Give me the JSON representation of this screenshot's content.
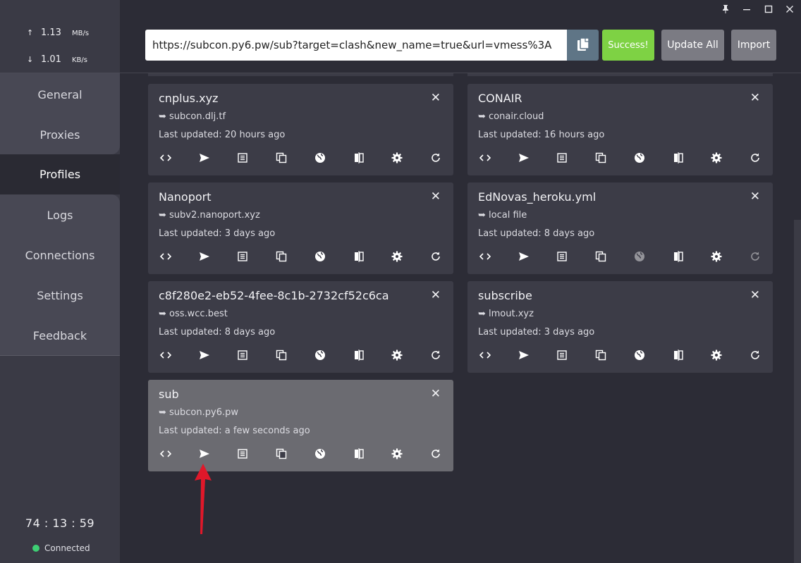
{
  "window_controls": [
    "pin-icon",
    "minimize-icon",
    "maximize-icon",
    "close-icon"
  ],
  "traffic": {
    "up_arrow": "↑",
    "up_value": "1.13",
    "up_unit": "MB/s",
    "down_arrow": "↓",
    "down_value": "1.01",
    "down_unit": "KB/s"
  },
  "nav": {
    "general": "General",
    "proxies": "Proxies",
    "profiles": "Profiles",
    "logs": "Logs",
    "connections": "Connections",
    "settings": "Settings",
    "feedback": "Feedback"
  },
  "active_nav": "Profiles",
  "uptime": "74 : 13 : 59",
  "connection_status": "Connected",
  "toolbar": {
    "url_value": "https://subcon.py6.pw/sub?target=clash&new_name=true&url=vmess%3A",
    "success_label": "Success!",
    "update_all_label": "Update All",
    "import_label": "Import"
  },
  "colors": {
    "success": "#7ed244",
    "status_dot": "#3ecf74",
    "card": "#3c3c47",
    "card_selected": "#6b6b71"
  },
  "profiles": [
    {
      "name": "cnplus.xyz",
      "source": "➥ subcon.dlj.tf",
      "updated": "Last updated: 20 hours ago"
    },
    {
      "name": "CONAIR",
      "source": "➥ conair.cloud",
      "updated": "Last updated: 16 hours ago"
    },
    {
      "name": "Nanoport",
      "source": "➥ subv2.nanoport.xyz",
      "updated": "Last updated: 3 days ago"
    },
    {
      "name": "EdNovas_heroku.yml",
      "source": "➥ local file",
      "updated": "Last updated: 8 days ago"
    },
    {
      "name": "c8f280e2-eb52-4fee-8c1b-2732cf52c6ca",
      "source": "➥ oss.wcc.best",
      "updated": "Last updated: 8 days ago"
    },
    {
      "name": "subscribe",
      "source": "➥ lmout.xyz",
      "updated": "Last updated: 3 days ago"
    },
    {
      "name": "sub",
      "source": "➥ subcon.py6.pw",
      "updated": "Last updated: a few seconds ago"
    }
  ],
  "card_actions": [
    "code-icon",
    "send-icon",
    "list-icon",
    "copy-icon",
    "globe-icon",
    "compare-icon",
    "gear-icon",
    "refresh-icon"
  ],
  "annotation": "red-arrow-pointing-to-send-icon"
}
